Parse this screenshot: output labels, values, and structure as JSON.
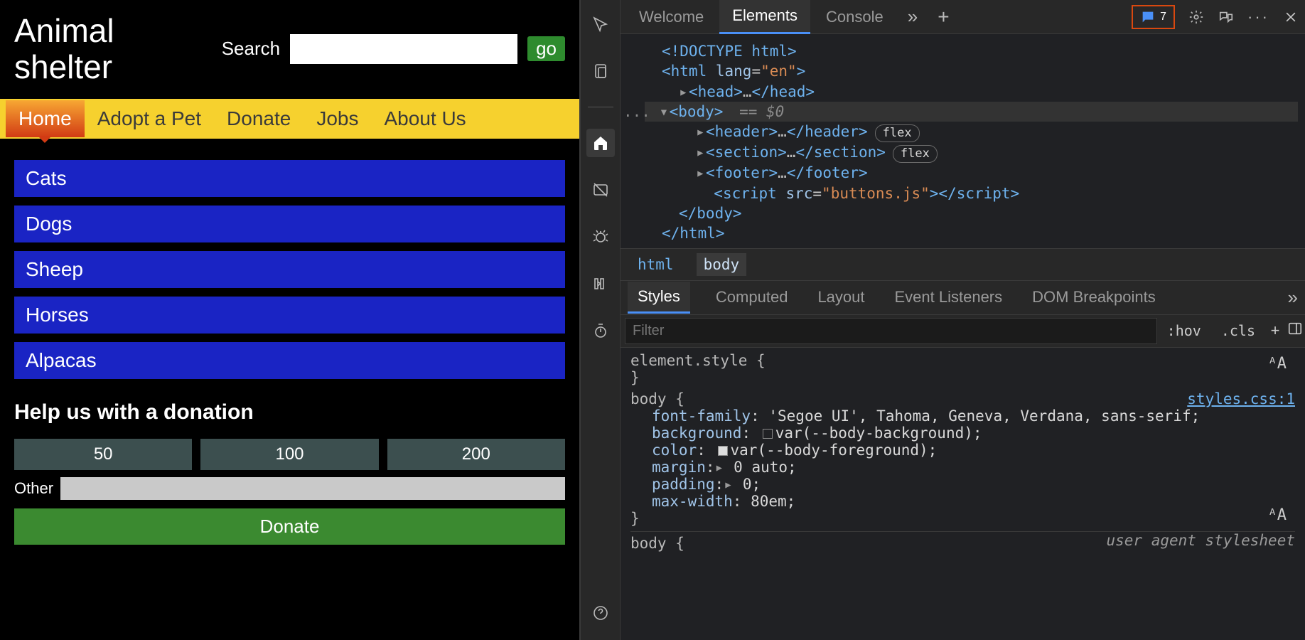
{
  "page": {
    "title": "Animal shelter",
    "search": {
      "label": "Search",
      "button": "go",
      "value": ""
    },
    "nav": [
      "Home",
      "Adopt a Pet",
      "Donate",
      "Jobs",
      "About Us"
    ],
    "nav_active": 0,
    "categories": [
      "Cats",
      "Dogs",
      "Sheep",
      "Horses",
      "Alpacas"
    ],
    "donation": {
      "heading": "Help us with a donation",
      "amounts": [
        "50",
        "100",
        "200"
      ],
      "other_label": "Other",
      "button": "Donate"
    }
  },
  "devtools": {
    "tabs": [
      "Welcome",
      "Elements",
      "Console"
    ],
    "tabs_active": 1,
    "issues_count": "7",
    "dom": {
      "doctype": "<!DOCTYPE html>",
      "html_open": "<html ",
      "html_attr_n": "lang",
      "html_attr_v": "\"en\"",
      "html_open_end": ">",
      "head_open": "<head>",
      "head_close": "</head>",
      "body_open": "<body>",
      "body_sel": " == $0",
      "header_open": "<header>",
      "header_close": "</header>",
      "section_open": "<section>",
      "section_close": "</section>",
      "footer_open": "<footer>",
      "footer_close": "</footer>",
      "script_open": "<script ",
      "script_attr_n": "src",
      "script_attr_v": "\"buttons.js\"",
      "script_open_end": ">",
      "script_close_tag": "</script>",
      "body_close": "</body>",
      "html_close": "</html>",
      "flex_pill": "flex",
      "ellipsis": "…",
      "leading_dots": "..."
    },
    "crumbs": [
      "html",
      "body"
    ],
    "crumbs_active": 1,
    "style_tabs": [
      "Styles",
      "Computed",
      "Layout",
      "Event Listeners",
      "DOM Breakpoints"
    ],
    "style_tabs_active": 0,
    "filter": {
      "placeholder": "Filter",
      "hov": ":hov",
      "cls": ".cls"
    },
    "rules": {
      "element_style": "element.style {",
      "close_brace": "}",
      "body_sel": "body {",
      "src_link": "styles.css:1",
      "p1_n": "font-family",
      "p1_v": " 'Segoe UI', Tahoma, Geneva, Verdana, sans-serif;",
      "p2_n": "background",
      "p2_v": "var(--body-background);",
      "p3_n": "color",
      "p3_v": "var(--body-foreground);",
      "p4_n": "margin",
      "p4_v": " 0 auto;",
      "p5_n": "padding",
      "p5_v": " 0;",
      "p6_n": "max-width",
      "p6_v": " 80em;",
      "ua_sel": "body {",
      "ua_note": "user agent stylesheet",
      "expand_tri": "▸"
    }
  }
}
